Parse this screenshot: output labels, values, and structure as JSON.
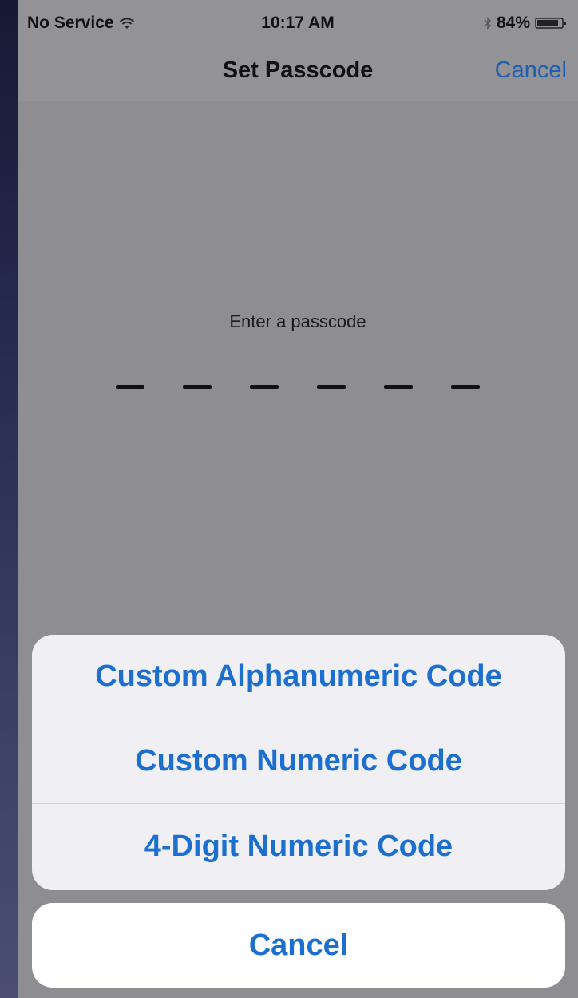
{
  "status_bar": {
    "carrier": "No Service",
    "time": "10:17 AM",
    "battery": "84%",
    "wifi_icon": "wifi-icon",
    "bluetooth_icon": "bluetooth-icon",
    "battery_icon": "battery-icon"
  },
  "nav": {
    "title": "Set Passcode",
    "cancel_label": "Cancel"
  },
  "passcode": {
    "prompt": "Enter a passcode",
    "digit_count": 6,
    "digits_entered": 0
  },
  "action_sheet": {
    "options": [
      {
        "label": "Custom Alphanumeric Code"
      },
      {
        "label": "Custom Numeric Code"
      },
      {
        "label": "4-Digit Numeric Code"
      }
    ],
    "cancel_label": "Cancel"
  },
  "colors": {
    "accent": "#1c6fcf",
    "dim_background": "#8d8d92",
    "sheet_background": "#efeff4"
  }
}
